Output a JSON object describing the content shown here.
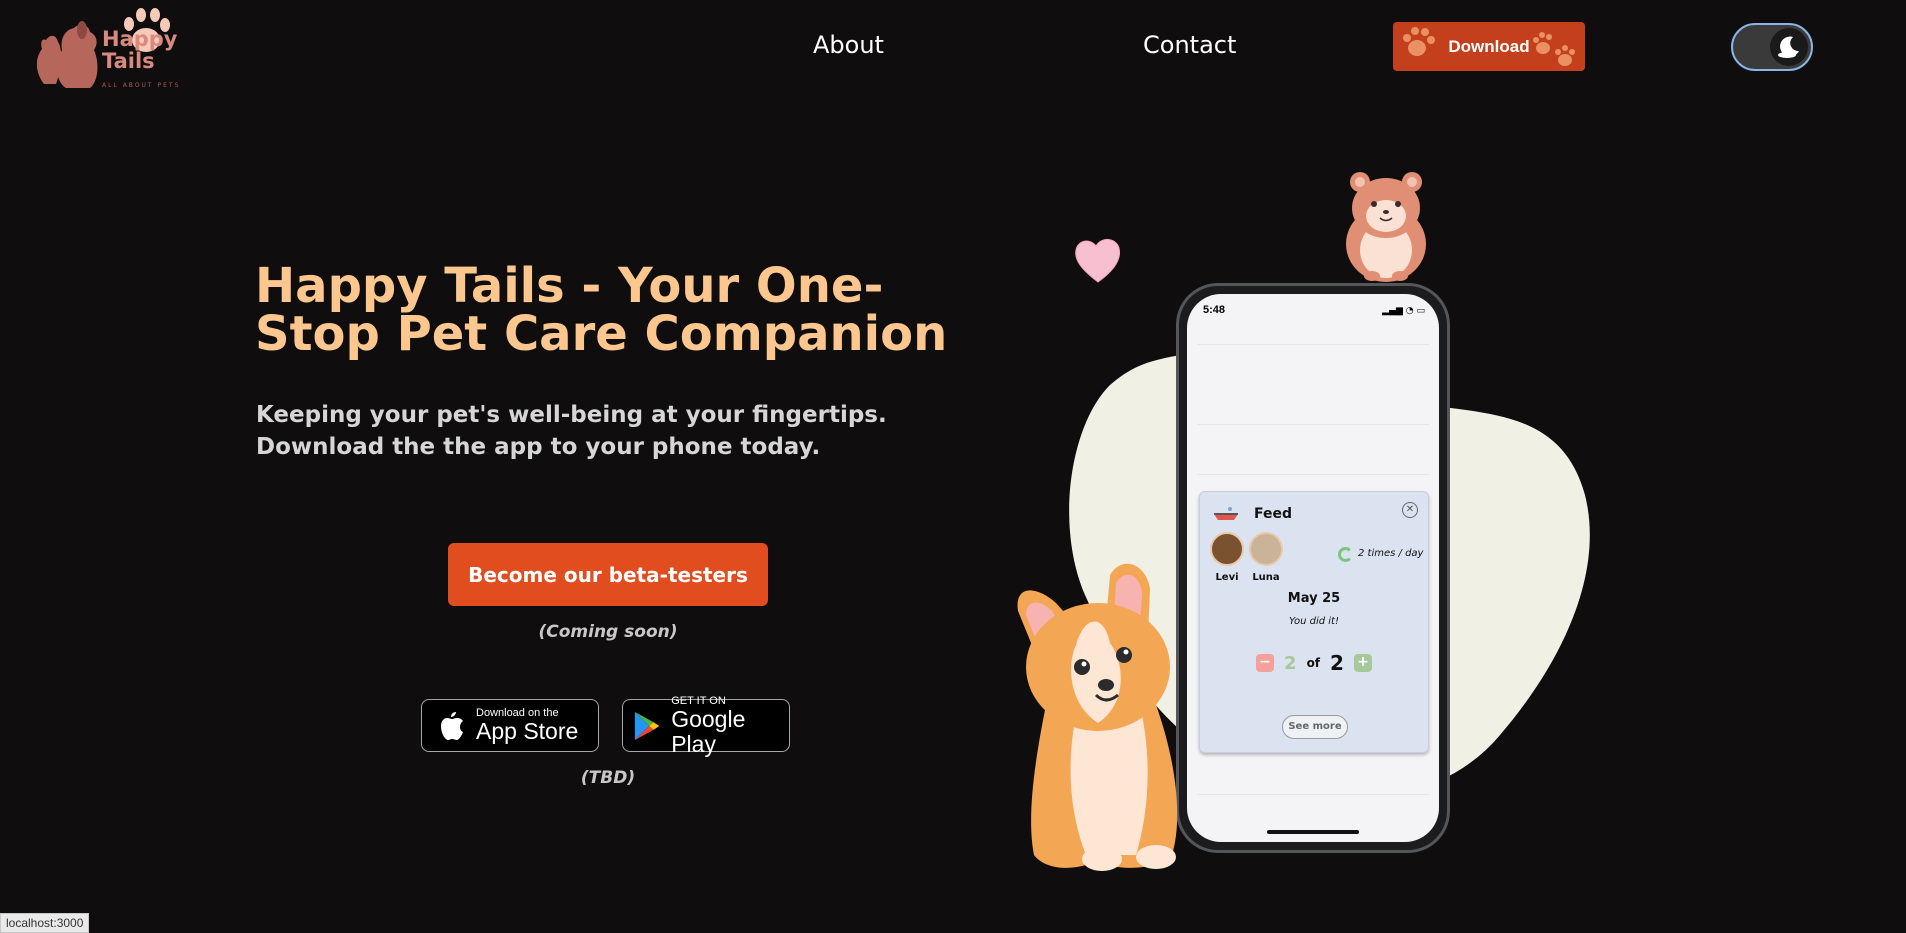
{
  "nav": {
    "logo_text": "Happy Tails",
    "logo_tagline": "ALL ABOUT PETS",
    "links": [
      {
        "label": "About"
      },
      {
        "label": "Contact"
      }
    ],
    "download_label": "Download",
    "theme_toggle_state": "dark"
  },
  "hero": {
    "title": "Happy Tails - Your One-Stop Pet Care Companion",
    "subtitle": "Keeping your pet's well-being at your fingertips. Download the the app to your phone today.",
    "cta_label": "Become our beta-testers",
    "cta_note": "(Coming soon)",
    "app_store": {
      "small": "Download on the",
      "big": "App Store"
    },
    "google_play": {
      "small": "GET IT ON",
      "big": "Google Play"
    },
    "stores_note": "(TBD)"
  },
  "phone": {
    "time": "5:48",
    "feed_card": {
      "title": "Feed",
      "pets": [
        "Levi",
        "Luna"
      ],
      "frequency": "2 times / day",
      "date": "May 25",
      "message": "You did it!",
      "count_current": "2",
      "count_of": "of",
      "count_total": "2",
      "see_more": "See more"
    }
  },
  "status_url": "localhost:3000",
  "colors": {
    "background": "#0f0d0e",
    "title": "#fbc78e",
    "cta": "#e24d20",
    "download": "#c4401c",
    "blob": "#f0f0e4"
  }
}
